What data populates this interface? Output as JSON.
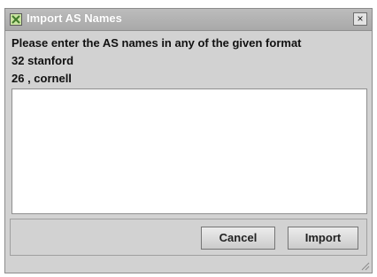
{
  "window": {
    "title": "Import AS Names",
    "close_glyph": "×"
  },
  "instructions": [
    "Please enter the AS names in any of the given format",
    "32 stanford",
    "26 , cornell"
  ],
  "input": {
    "value": ""
  },
  "buttons": {
    "cancel": "Cancel",
    "import": "Import"
  },
  "icons": {
    "window": "app-icon",
    "close": "close-icon",
    "resize": "resize-grip-icon"
  }
}
